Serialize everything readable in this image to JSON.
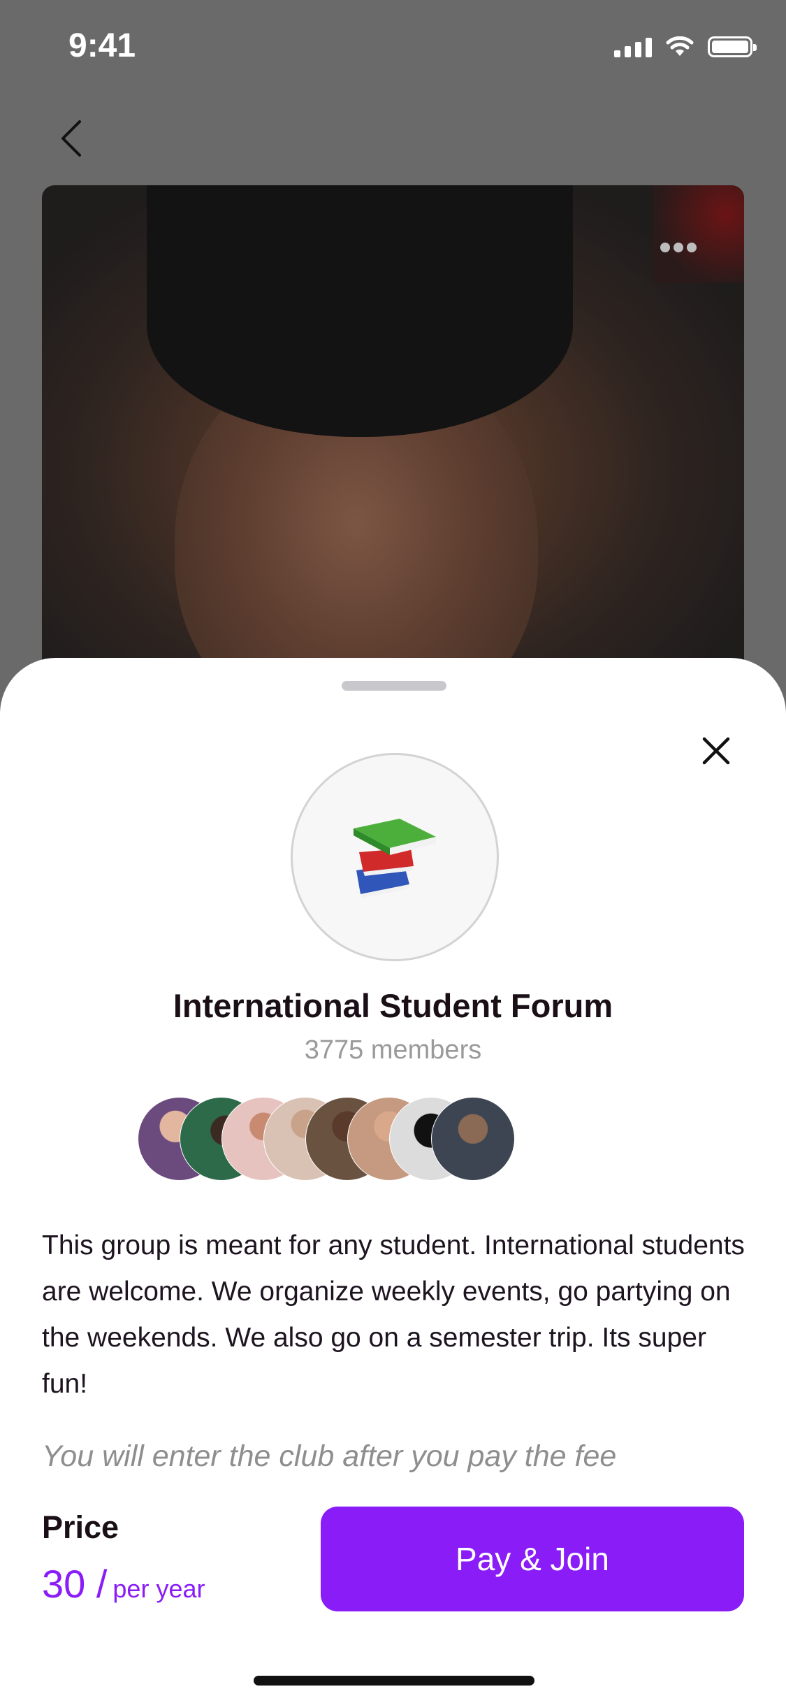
{
  "status_bar": {
    "time": "9:41"
  },
  "group": {
    "name": "International Student Forum",
    "members": "3775 members",
    "description": "This group is meant for any student. International students are welcome. We organize weekly events, go partying on the weekends. We also go on a semester trip. Its super fun!",
    "notice": "You will enter the club after you pay the fee",
    "member_avatar_colors": [
      "#6b4a7e",
      "#2d6a4a",
      "#e7c3c0",
      "#d9c2b3",
      "#6a5240",
      "#c69a80",
      "#222222",
      "#3e4552"
    ]
  },
  "price": {
    "label": "Price",
    "amount": "30 /",
    "period": "per year"
  },
  "actions": {
    "pay_join": "Pay & Join"
  },
  "colors": {
    "accent": "#8a1cf7",
    "title": "#1a0f16",
    "muted": "#9a9a9a"
  },
  "icons": {
    "group": "books-icon",
    "back": "chevron-left-icon",
    "close": "close-icon",
    "more": "more-horizontal-icon"
  }
}
